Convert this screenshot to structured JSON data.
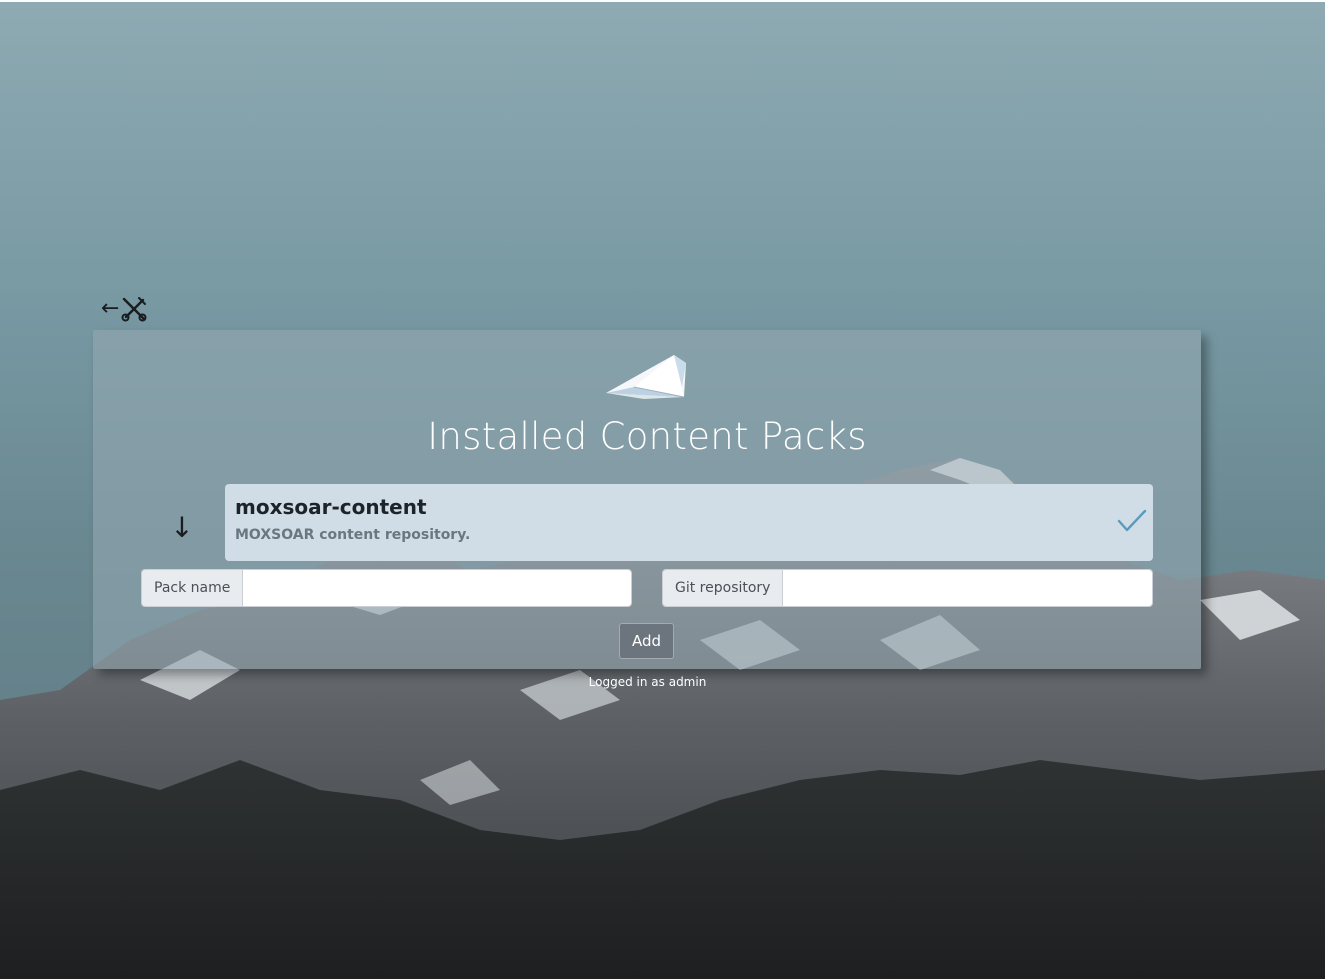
{
  "nav": {
    "back_glyph": "←",
    "tools_icon": "wrench-screwdriver-icon"
  },
  "panel": {
    "logo_icon": "paper-plane-logo",
    "title": "Installed Content Packs"
  },
  "packs": [
    {
      "name": "moxsoar-content",
      "description": "MOXSOAR content repository.",
      "installed": true,
      "status_icon": "checkmark-icon"
    }
  ],
  "download_icon": "arrow-down-icon",
  "form": {
    "pack_name_label": "Pack name",
    "pack_name_value": "",
    "git_repo_label": "Git repository",
    "git_repo_value": "",
    "add_label": "Add"
  },
  "footer": {
    "logged_in_text": "Logged in as admin"
  },
  "colors": {
    "accent": "#5a9bbd",
    "panel_bg": "#96aab2",
    "pack_bg": "#d0dde6"
  }
}
